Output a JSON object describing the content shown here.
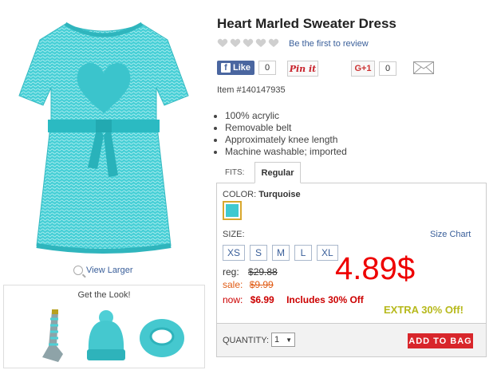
{
  "product": {
    "title": "Heart Marled Sweater Dress",
    "review_link": "Be the first to review",
    "rating": 0,
    "rating_max": 5,
    "item_number": "Item #140147935",
    "bullets": [
      "100% acrylic",
      "Removable belt",
      "Approximately knee length",
      "Machine washable; imported"
    ],
    "main_color": "#40c9d0"
  },
  "image": {
    "view_larger": "View Larger"
  },
  "get_look": {
    "title": "Get the Look!"
  },
  "social": {
    "fb_label": "Like",
    "fb_count": "0",
    "pin_label": "Pin it",
    "gplus_label": "G+1",
    "gplus_count": "0"
  },
  "fits": {
    "label": "FITS:",
    "selected_tab": "Regular"
  },
  "color": {
    "label": "COLOR:",
    "value": "Turquoise"
  },
  "size": {
    "label": "SIZE:",
    "chart_link": "Size Chart",
    "options": [
      "XS",
      "S",
      "M",
      "L",
      "XL"
    ]
  },
  "pricing": {
    "reg_label": "reg:",
    "reg_price": "$29.88",
    "sale_label": "sale:",
    "sale_price": "$9.99",
    "now_label": "now:",
    "now_price": "$6.99",
    "includes": "Includes 30% Off",
    "big_price": "4.89$",
    "extra": "EXTRA 30% Off!"
  },
  "quantity": {
    "label": "QUANTITY:",
    "value": "1",
    "add_to_bag": "ADD TO BAG"
  },
  "colors": {
    "link": "#3a5f9a",
    "add_to_bag_bg": "#d8262b",
    "extra_text": "#b7b91c",
    "big_price": "#e00000"
  }
}
